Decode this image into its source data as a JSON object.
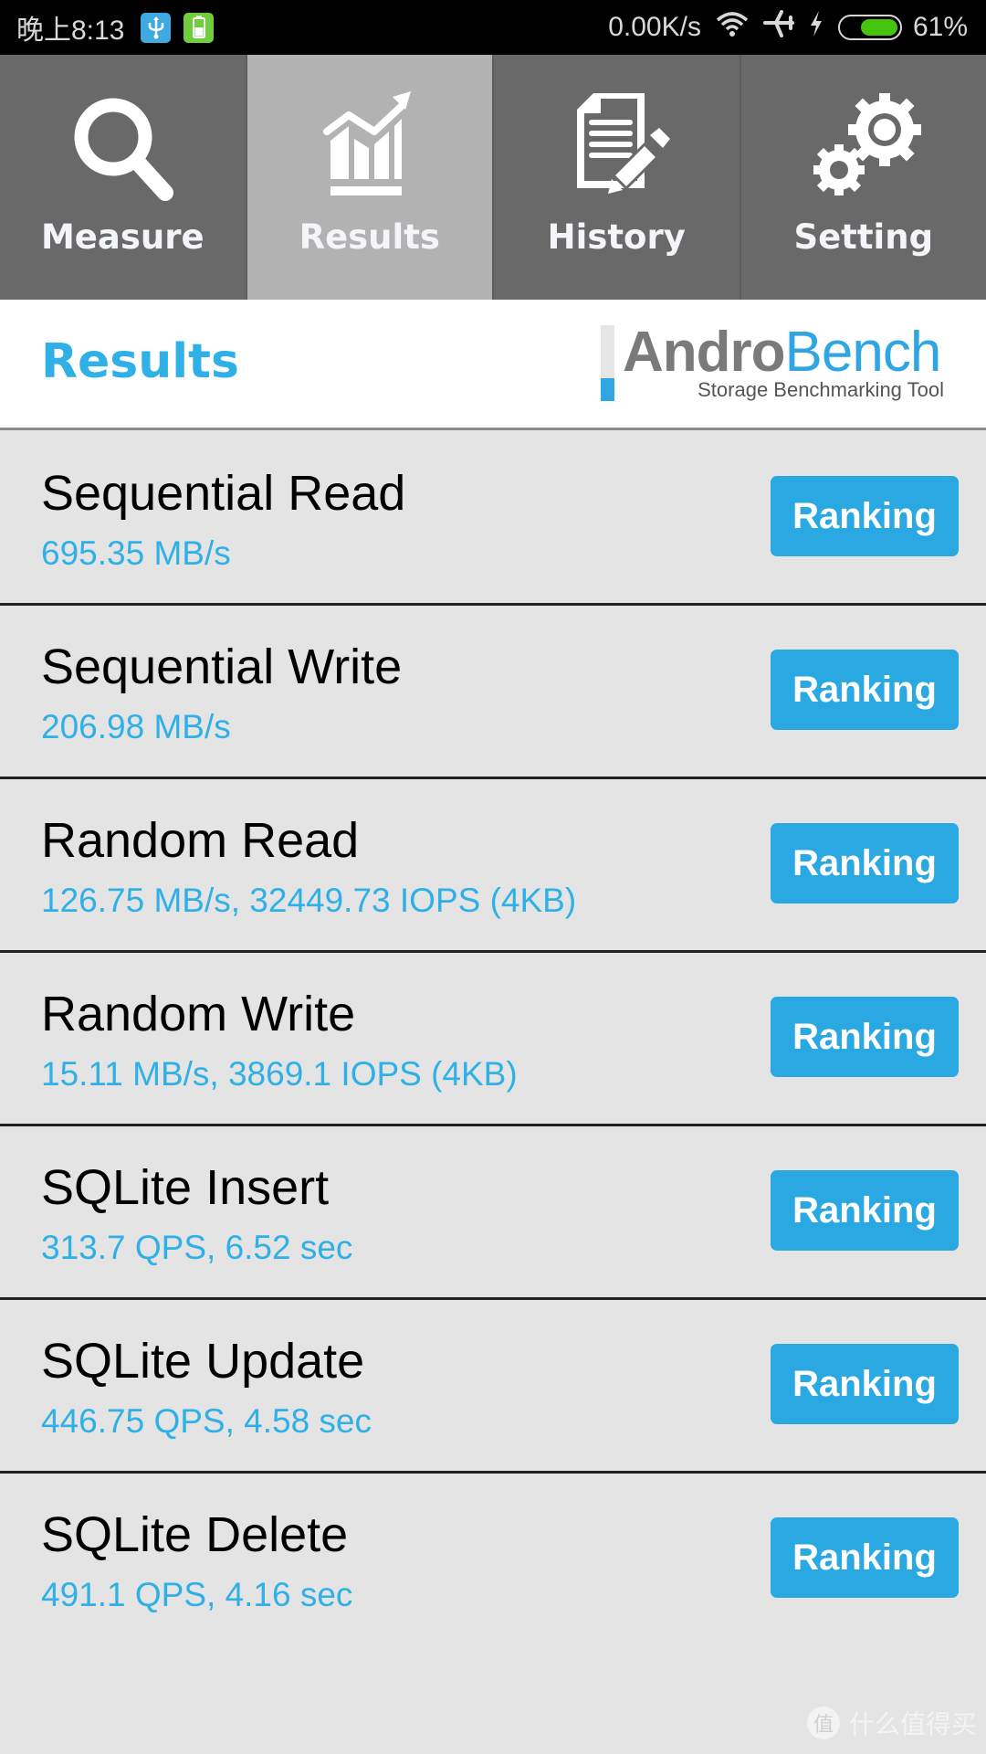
{
  "status_bar": {
    "time": "晚上8:13",
    "net_speed": "0.00K/s",
    "battery_percent_label": "61%",
    "battery_level": 0.61,
    "icons": [
      "usb-icon",
      "battery-saver-icon",
      "wifi-icon",
      "airplane-icon",
      "charging-icon",
      "battery-icon"
    ]
  },
  "tabs": [
    {
      "label": "Measure",
      "icon": "magnifier-icon",
      "active": false
    },
    {
      "label": "Results",
      "icon": "chart-trend-icon",
      "active": true
    },
    {
      "label": "History",
      "icon": "document-pencil-icon",
      "active": false
    },
    {
      "label": "Setting",
      "icon": "gears-icon",
      "active": false
    }
  ],
  "header": {
    "title": "Results",
    "logo": {
      "part1": "Andro",
      "part2": "Bench",
      "tagline": "Storage Benchmarking Tool"
    }
  },
  "results": [
    {
      "name": "Sequential Read",
      "value": "695.35 MB/s",
      "button": "Ranking"
    },
    {
      "name": "Sequential Write",
      "value": "206.98 MB/s",
      "button": "Ranking"
    },
    {
      "name": "Random Read",
      "value": "126.75 MB/s, 32449.73 IOPS (4KB)",
      "button": "Ranking"
    },
    {
      "name": "Random Write",
      "value": "15.11 MB/s, 3869.1 IOPS (4KB)",
      "button": "Ranking"
    },
    {
      "name": "SQLite Insert",
      "value": "313.7 QPS, 6.52 sec",
      "button": "Ranking"
    },
    {
      "name": "SQLite Update",
      "value": "446.75 QPS, 4.58 sec",
      "button": "Ranking"
    },
    {
      "name": "SQLite Delete",
      "value": "491.1 QPS, 4.16 sec",
      "button": "Ranking"
    }
  ],
  "watermark": {
    "badge": "值",
    "text": "什么值得买"
  },
  "colors": {
    "accent": "#29a8e2",
    "tab_active": "#b2b2b2",
    "tab_inactive": "#696969",
    "value_text": "#2fb0e6"
  }
}
